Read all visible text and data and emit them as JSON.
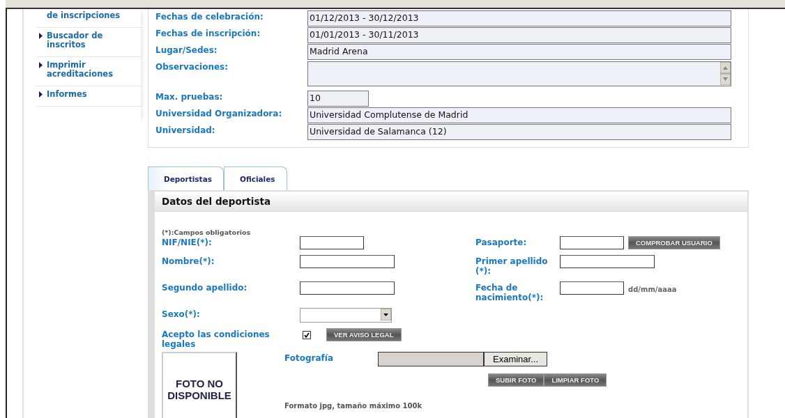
{
  "sidebar": {
    "items": [
      {
        "label": "de inscripciones",
        "bullet": false
      },
      {
        "label": "Buscador de inscritos",
        "bullet": true
      },
      {
        "label": "Imprimir acreditaciones",
        "bullet": true
      },
      {
        "label": "Informes",
        "bullet": true
      }
    ]
  },
  "event_info": {
    "fields": [
      {
        "label": "Fechas de celebración:",
        "value": "01/12/2013 - 30/12/2013",
        "kind": "text"
      },
      {
        "label": "Fechas de inscripción:",
        "value": "01/01/2013 - 30/11/2013",
        "kind": "text"
      },
      {
        "label": "Lugar/Sedes:",
        "value": "Madrid Arena",
        "kind": "text"
      },
      {
        "label": "Observaciones:",
        "kind": "textarea"
      },
      {
        "label": "Max. pruebas:",
        "value": "10",
        "kind": "short"
      },
      {
        "label": "Universidad Organizadora:",
        "value": "Universidad Complutense de Madrid",
        "kind": "text"
      },
      {
        "label": "Universidad:",
        "value": "Universidad de Salamanca (12)",
        "kind": "text"
      }
    ]
  },
  "tabs": [
    {
      "label": "Deportistas",
      "selected": true
    },
    {
      "label": "Oficiales",
      "selected": false
    }
  ],
  "athlete_form": {
    "title": "Datos del deportista",
    "required_note": "(*):Campos obligatorios",
    "rows": [
      {
        "left": {
          "label": "NIF/NIE(*):",
          "kind": "short_text"
        },
        "right": {
          "label": "Pasaporte:",
          "kind": "short_text",
          "button": "COMPROBAR USUARIO"
        }
      },
      {
        "left": {
          "label": "Nombre(*):",
          "kind": "text"
        },
        "right": {
          "label": "Primer apellido (*):",
          "kind": "text"
        }
      },
      {
        "left": {
          "label": "Segundo apellido:",
          "kind": "text"
        },
        "right": {
          "label": "Fecha de nacimiento(*):",
          "kind": "short_text",
          "hint": "dd/mm/aaaa"
        }
      },
      {
        "left": {
          "label": "Sexo(*):",
          "kind": "select"
        }
      },
      {
        "left": {
          "label": "Acepto las condiciones legales",
          "kind": "checkbox",
          "checked": true,
          "button": "VER AVISO LEGAL"
        }
      }
    ],
    "photo": {
      "placeholder_text": "FOTO NO DISPONIBLE",
      "label": "Fotografía",
      "browse_button": "Examinar...",
      "buttons": [
        "SUBIR FOTO",
        "LIMPIAR FOTO"
      ],
      "note": "Formato jpg, tamaño máximo 100k"
    }
  }
}
